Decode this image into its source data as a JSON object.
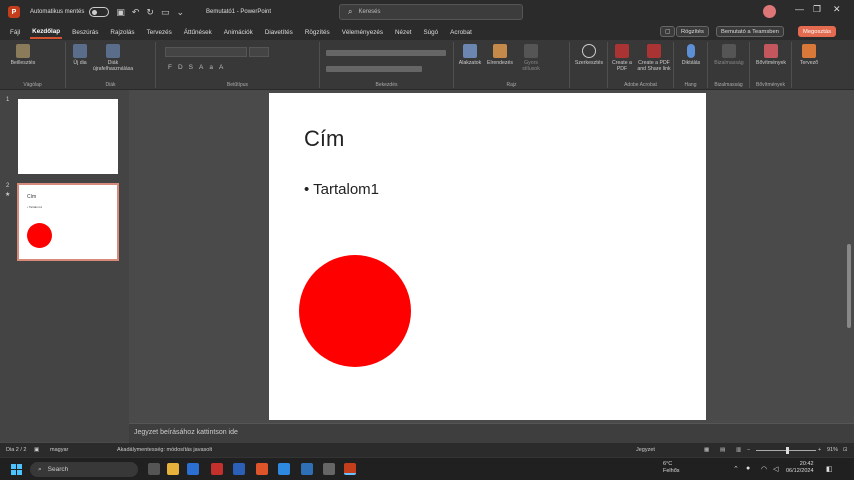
{
  "titlebar": {
    "autosave_label": "Automatikus mentés",
    "doc_title": "Bemutató1  -  PowerPoint",
    "search_placeholder": "Keresés"
  },
  "tabs": [
    "Fájl",
    "Kezdőlap",
    "Beszúrás",
    "Rajzolás",
    "Tervezés",
    "Áttűnések",
    "Animációk",
    "Diavetítés",
    "Rögzítés",
    "Véleményezés",
    "Nézet",
    "Súgó",
    "Acrobat"
  ],
  "tab_actions": {
    "record": "Rögzítés",
    "teams": "Bemutató a Teamsben",
    "share": "Megosztás"
  },
  "ribbon": {
    "paste": "Beillesztés",
    "new_slide": "Új dia",
    "reuse_slides": "Diák újrafelhasználása",
    "shapes": "Alakzatok",
    "arrange": "Elrendezés",
    "quick_styles": "Gyors stílusok",
    "editing": "Szerkesztés",
    "create_pdf": "Create a PDF",
    "create_pdf_share": "Create a PDF and Share link",
    "dictate": "Diktálás",
    "sensitivity": "Bizalmasság",
    "addins": "Bővítmények",
    "designer": "Tervező",
    "groups": {
      "clipboard": "Vágólap",
      "slides": "Diák",
      "font": "Betűtípus",
      "paragraph": "Bekezdés",
      "drawing": "Rajz",
      "acrobat": "Adobe Acrobat",
      "voice": "Hang",
      "sensitivity": "Bizalmasság",
      "addins": "Bővítmények"
    }
  },
  "thumbnails": [
    {
      "number": "1"
    },
    {
      "number": "2",
      "title": "Cím",
      "bullet": "• Tartalom1"
    }
  ],
  "slide": {
    "title": "Cím",
    "bullet": "• Tartalom1",
    "shape_color": "#ff0000"
  },
  "notes_placeholder": "Jegyzet beírásához kattintson ide",
  "statusbar": {
    "slide_count": "Dia 2 / 2",
    "language": "magyar",
    "accessibility": "Akadálymentesség: módosítás javasolt",
    "notes": "Jegyzet",
    "zoom": "91%"
  },
  "taskbar": {
    "search": "Search",
    "temp": "6°C",
    "weather": "Felhős",
    "time": "20:42",
    "date": "06/12/2024"
  },
  "colors": {
    "accent": "#d35230",
    "share": "#e46b4f"
  }
}
